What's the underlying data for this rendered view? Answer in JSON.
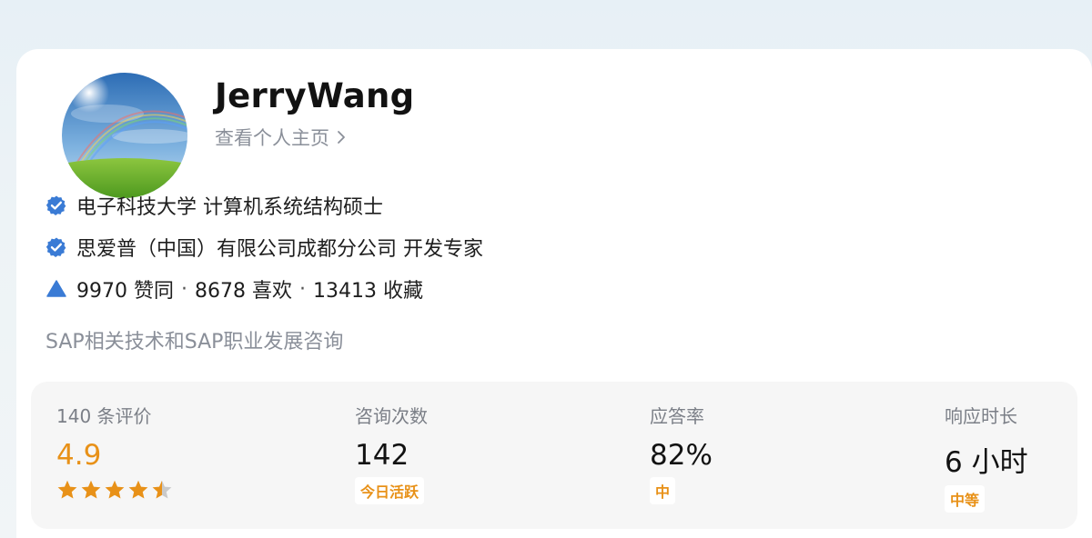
{
  "profile": {
    "name": "JerryWang",
    "view_profile": "查看个人主页"
  },
  "credentials": {
    "education": "电子科技大学 计算机系统结构硕士",
    "work": "思爱普（中国）有限公司成都分公司 开发专家"
  },
  "achievements": {
    "upvotes": "9970 赞同",
    "likes": "8678 喜欢",
    "favorites": "13413 收藏",
    "separator": "·"
  },
  "description": "SAP相关技术和SAP职业发展咨询",
  "stats": {
    "reviews": {
      "label": "140 条评价",
      "value": "4.9",
      "rating": 4.5,
      "max": 5
    },
    "consults": {
      "label": "咨询次数",
      "value": "142",
      "tag": "今日活跃"
    },
    "answer_rate": {
      "label": "应答率",
      "value": "82%",
      "tag": "中"
    },
    "response": {
      "label": "响应时长",
      "value": "6 小时",
      "tag": "中等"
    }
  },
  "colors": {
    "accent_orange": "#e89118",
    "verified_blue": "#3a7bd5",
    "text_gray": "#8a8f99"
  },
  "icons": {
    "verified": "verified-badge-icon",
    "upvote": "triangle-up-icon",
    "chevron": "chevron-right-icon",
    "star": "star-icon"
  }
}
